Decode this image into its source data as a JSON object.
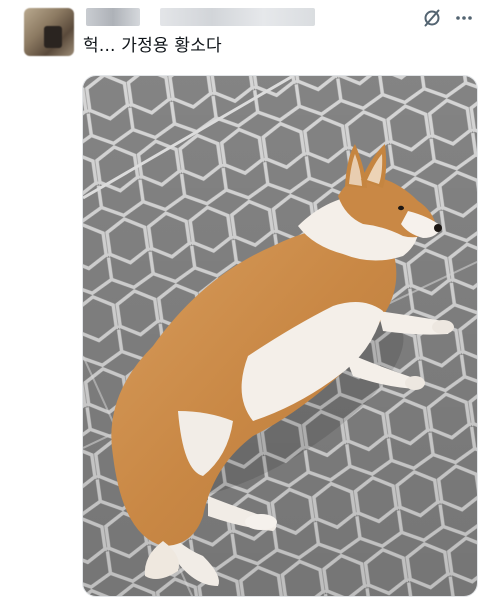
{
  "post": {
    "text": "헉... 가정용 황소다"
  },
  "icons": {
    "grok": "slashed-circle-icon",
    "more": "more-dots-icon"
  },
  "colors": {
    "text": "#0f1419",
    "icon": "#536471"
  }
}
